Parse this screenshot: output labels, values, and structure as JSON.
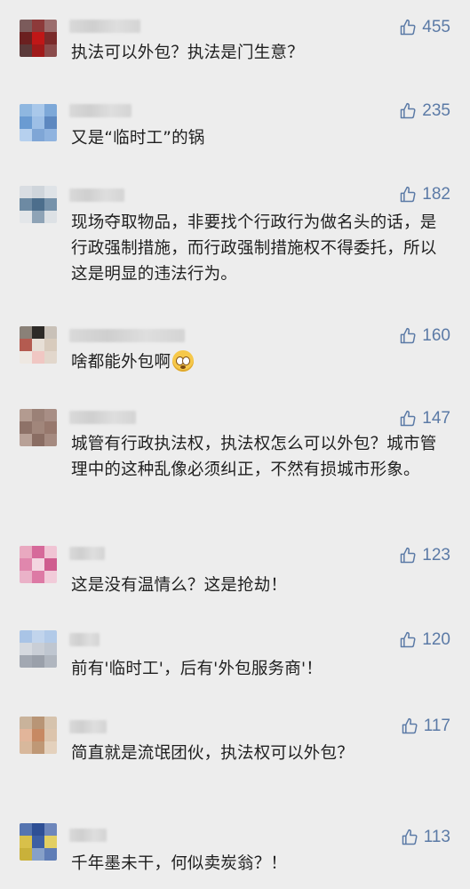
{
  "comments": [
    {
      "likes": "455",
      "text": "执法可以外包？执法是门生意？"
    },
    {
      "likes": "235",
      "text": "又是“临时工”的锅"
    },
    {
      "likes": "182",
      "text": "现场夺取物品，非要找个行政行为做名头的话，是行政强制措施，而行政强制措施权不得委托，所以这是明显的违法行为。"
    },
    {
      "likes": "160",
      "text": "啥都能外包啊",
      "emoji": "flushed-face"
    },
    {
      "likes": "147",
      "text": "城管有行政执法权，执法权怎么可以外包？城市管理中的这种乱像必须纠正，不然有损城市形象。"
    },
    {
      "likes": "123",
      "text": "这是没有温情么？这是抢劫！"
    },
    {
      "likes": "120",
      "text": "前有'临时工'，后有'外包服务商'！"
    },
    {
      "likes": "117",
      "text": "简直就是流氓团伙，执法权可以外包？"
    },
    {
      "likes": "113",
      "text": "千年墨未干，何似卖炭翁？！"
    }
  ],
  "colors": {
    "like": "#5b7aa6",
    "text": "#1f1f1f",
    "background": "#ededed"
  },
  "icons": {
    "like": "thumbs-up-icon"
  }
}
